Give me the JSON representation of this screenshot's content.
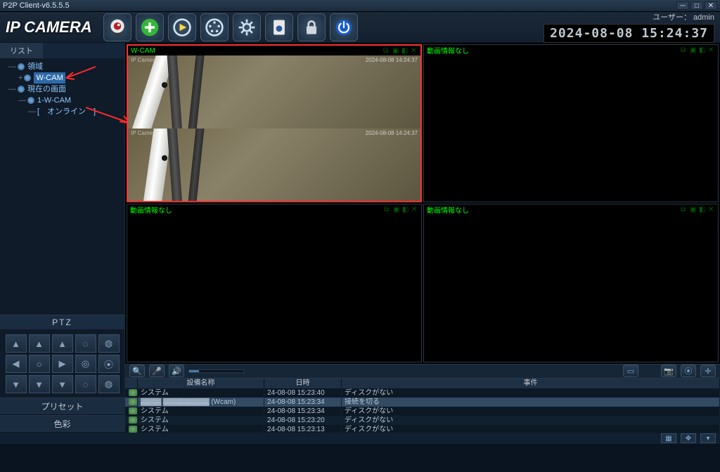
{
  "window": {
    "title": "P2P Client-v6.5.5.5"
  },
  "brand": "IP CAMERA",
  "user": {
    "label": "ユーザー：",
    "name": "admin"
  },
  "clock": "2024-08-08 15:24:37",
  "toolbar_icons": [
    "webcam",
    "add",
    "play",
    "record",
    "settings",
    "doc",
    "lock",
    "power"
  ],
  "side_tab": "リスト",
  "tree": {
    "root1": "領域",
    "wcam": "W-CAM",
    "root2": "現在の画面",
    "group": "1-W-CAM",
    "status": "[　オンライン　]"
  },
  "ptz": {
    "title": "PTZ",
    "preset": "プリセット",
    "color": "色彩"
  },
  "cells": {
    "active_label": "W-CAM",
    "no_video": "動画情報なし",
    "frame_ts1": "2024-08-08 14:24:37",
    "frame_ts2": "2024-08-08 14:24:37"
  },
  "log": {
    "cols": {
      "name": "設備名称",
      "time": "日時",
      "event": "事件"
    },
    "rows": [
      {
        "name": "システム",
        "time": "24-08-08 15:23:40",
        "event": "ディスクがない"
      },
      {
        "name": "▓▓▓▓ ▓▓▓▓▓▓▓▓▓ (Wcam)",
        "time": "24-08-08 15:23:34",
        "event": "接続を切る",
        "hilite": true
      },
      {
        "name": "システム",
        "time": "24-08-08 15:23:34",
        "event": "ディスクがない"
      },
      {
        "name": "システム",
        "time": "24-08-08 15:23:20",
        "event": "ディスクがない"
      },
      {
        "name": "システム",
        "time": "24-08-08 15:23:13",
        "event": "ディスクがない"
      }
    ]
  }
}
